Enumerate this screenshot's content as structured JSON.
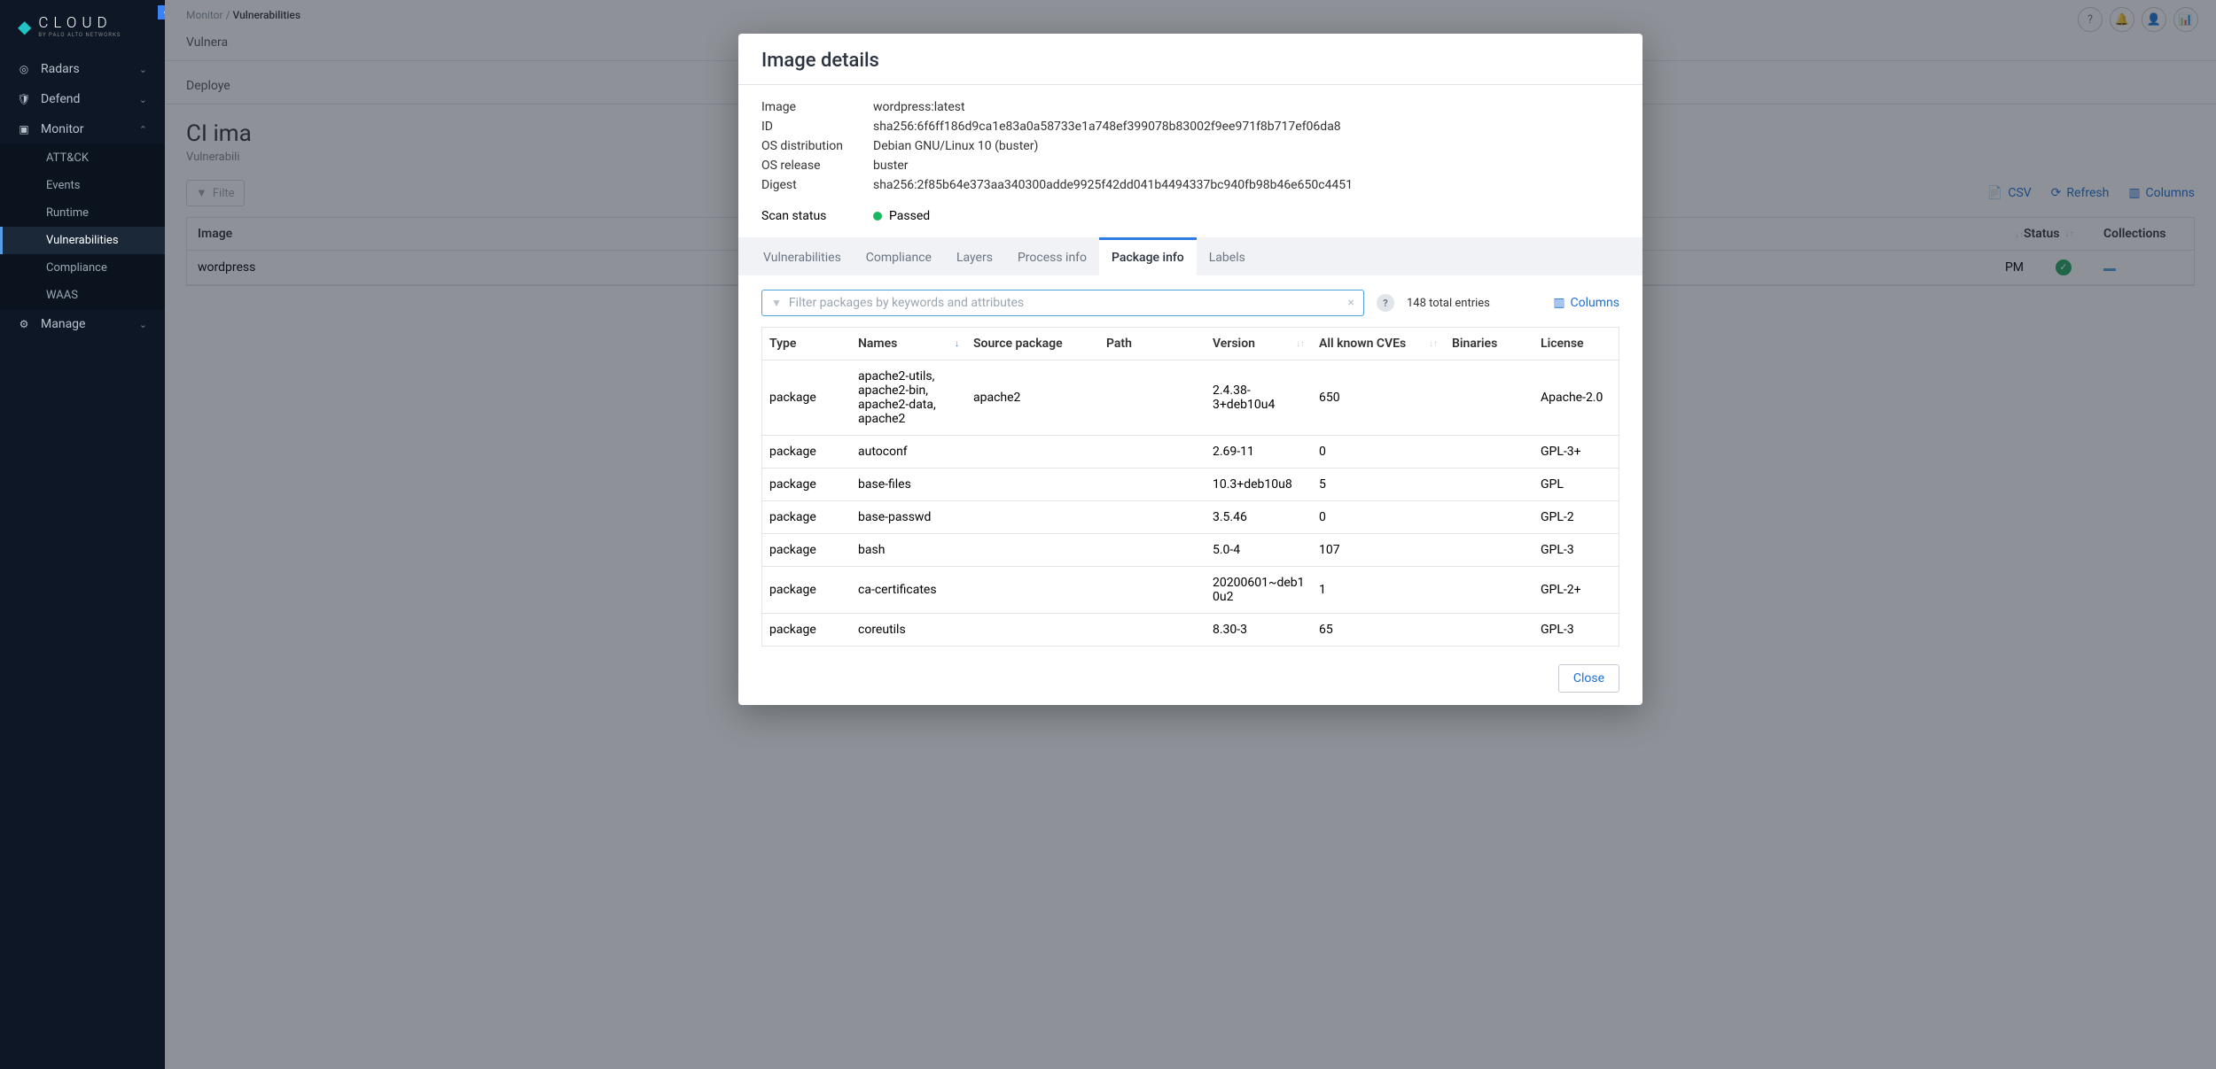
{
  "brand": {
    "name": "CLOUD",
    "subtitle": "BY PALO ALTO NETWORKS"
  },
  "breadcrumb": {
    "parent": "Monitor",
    "current": "Vulnerabilities"
  },
  "nav": {
    "items": [
      {
        "label": "Radars",
        "icon": "◎"
      },
      {
        "label": "Defend",
        "icon": "🛡"
      },
      {
        "label": "Monitor",
        "icon": "▣",
        "expanded": true
      },
      {
        "label": "Manage",
        "icon": "⚙"
      }
    ],
    "sub": [
      {
        "label": "ATT&CK"
      },
      {
        "label": "Events"
      },
      {
        "label": "Runtime"
      },
      {
        "label": "Vulnerabilities",
        "active": true
      },
      {
        "label": "Compliance"
      },
      {
        "label": "WAAS"
      }
    ]
  },
  "tabs1": {
    "visible": "Vulnera"
  },
  "tabs2": {
    "visible": "Deploye"
  },
  "page": {
    "title_partial": "CI ima",
    "subtitle_partial": "Vulnerabili"
  },
  "bg_toolbar": {
    "filter_label": "Filte",
    "csv": "CSV",
    "refresh": "Refresh",
    "columns": "Columns"
  },
  "bg_table": {
    "headers": {
      "image": "Image",
      "status": "Status",
      "collections": "Collections"
    },
    "row": {
      "image": "wordpress",
      "time": "PM"
    }
  },
  "modal": {
    "title": "Image details",
    "meta": [
      {
        "k": "Image",
        "v": "wordpress:latest"
      },
      {
        "k": "ID",
        "v": "sha256:6f6ff186d9ca1e83a0a58733e1a748ef399078b83002f9ee971f8b717ef06da8"
      },
      {
        "k": "OS distribution",
        "v": "Debian GNU/Linux 10 (buster)"
      },
      {
        "k": "OS release",
        "v": "buster"
      },
      {
        "k": "Digest",
        "v": "sha256:2f85b64e373aa340300adde9925f42dd041b4494337bc940fb98b46e650c4451"
      }
    ],
    "scan": {
      "label": "Scan status",
      "value": "Passed"
    },
    "tabs": [
      "Vulnerabilities",
      "Compliance",
      "Layers",
      "Process info",
      "Package info",
      "Labels"
    ],
    "active_tab": "Package info",
    "filter_placeholder": "Filter packages by keywords and attributes",
    "entries": "148 total entries",
    "columns_btn": "Columns",
    "table": {
      "headers": {
        "type": "Type",
        "names": "Names",
        "src": "Source package",
        "path": "Path",
        "version": "Version",
        "cve": "All known CVEs",
        "bin": "Binaries",
        "lic": "License"
      },
      "rows": [
        {
          "type": "package",
          "names": "apache2-utils, apache2-bin, apache2-data, apache2",
          "src": "apache2",
          "path": "",
          "version": "2.4.38-3+deb10u4",
          "cve": "650",
          "bin": "",
          "lic": "Apache-2.0"
        },
        {
          "type": "package",
          "names": "autoconf",
          "src": "",
          "path": "",
          "version": "2.69-11",
          "cve": "0",
          "bin": "",
          "lic": "GPL-3+"
        },
        {
          "type": "package",
          "names": "base-files",
          "src": "",
          "path": "",
          "version": "10.3+deb10u8",
          "cve": "5",
          "bin": "",
          "lic": "GPL"
        },
        {
          "type": "package",
          "names": "base-passwd",
          "src": "",
          "path": "",
          "version": "3.5.46",
          "cve": "0",
          "bin": "",
          "lic": "GPL-2"
        },
        {
          "type": "package",
          "names": "bash",
          "src": "",
          "path": "",
          "version": "5.0-4",
          "cve": "107",
          "bin": "",
          "lic": "GPL-3"
        },
        {
          "type": "package",
          "names": "ca-certificates",
          "src": "",
          "path": "",
          "version": "20200601~deb10u2",
          "cve": "1",
          "bin": "",
          "lic": "GPL-2+"
        },
        {
          "type": "package",
          "names": "coreutils",
          "src": "",
          "path": "",
          "version": "8.30-3",
          "cve": "65",
          "bin": "",
          "lic": "GPL-3"
        }
      ]
    },
    "close": "Close"
  }
}
